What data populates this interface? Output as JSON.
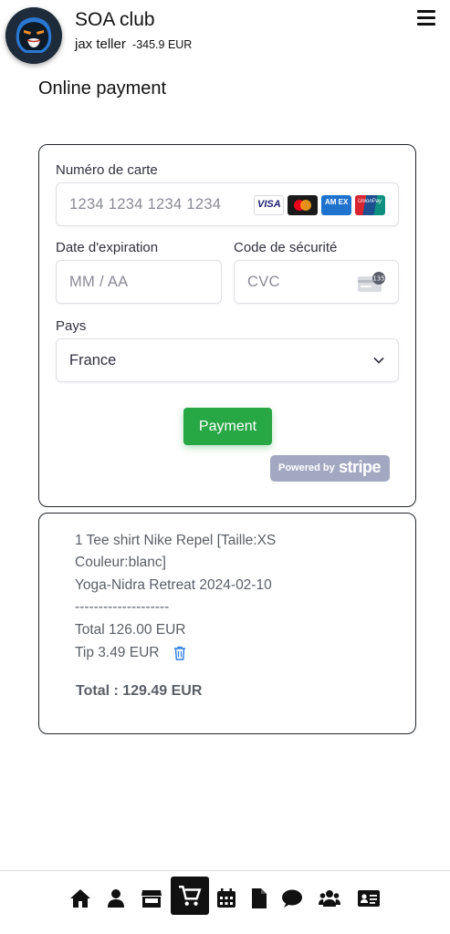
{
  "header": {
    "club_name": "SOA club",
    "user_name": "jax teller",
    "balance": "-345.9 EUR"
  },
  "page_title": "Online payment",
  "payment_form": {
    "card_number_label": "Numéro de carte",
    "card_number_placeholder": "1234 1234 1234 1234",
    "card_brands": [
      "VISA",
      "Mastercard",
      "American Express",
      "UnionPay"
    ],
    "visa_text": "VISA",
    "amex_text": "AM EX",
    "unionpay_text": "UnionPay",
    "expiry_label": "Date d'expiration",
    "expiry_placeholder": "MM / AA",
    "cvc_label": "Code de sécurité",
    "cvc_placeholder": "CVC",
    "cvc_badge": "135",
    "country_label": "Pays",
    "country_value": "France",
    "payment_button": "Payment",
    "powered_by": "Powered by",
    "stripe": "stripe"
  },
  "summary": {
    "lines": [
      "1 Tee shirt Nike Repel [Taille:XS",
      "Couleur:blanc]",
      "Yoga-Nidra Retreat 2024-02-10",
      "--------------------",
      "Total 126.00 EUR"
    ],
    "tip": "Tip 3.49 EUR",
    "total": "Total : 129.49 EUR"
  },
  "bottom_nav": {
    "items": [
      "home",
      "profile",
      "shop",
      "cart",
      "calendar",
      "document",
      "chat",
      "members",
      "id-card"
    ],
    "active": "cart"
  },
  "colors": {
    "primary_button": "#28a745",
    "stripe_badge": "#a3a8c2",
    "trash_icon": "#2b7de9",
    "text": "#111111"
  }
}
